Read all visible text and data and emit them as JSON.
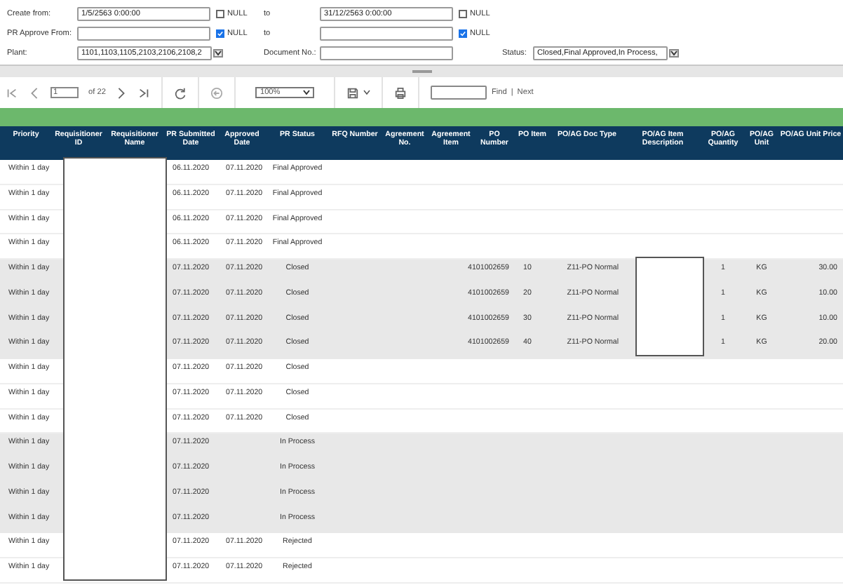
{
  "filters": {
    "rows": [
      {
        "label": "Create from:",
        "value": "1/5/2563 0:00:00",
        "null_label": "NULL",
        "null_checked": false,
        "to_label": "to",
        "to_value": "31/12/2563 0:00:00",
        "to_null_label": "NULL",
        "to_null_checked": false
      },
      {
        "label": "PR Approve From:",
        "null_label": "NULL",
        "null_checked": true,
        "to_label": "to",
        "to_null_label": "NULL",
        "to_null_checked": true
      }
    ],
    "plant": {
      "label": "Plant:",
      "value": "1101,1103,1105,2103,2106,2108,2"
    },
    "document": {
      "label": "Document No.:"
    },
    "status": {
      "label": "Status:",
      "value": "Closed,Final Approved,In Process,"
    }
  },
  "toolbar": {
    "page": "1",
    "of_label": "of 22",
    "zoom": "100%",
    "find_label": "Find",
    "separator": "|",
    "next_label": "Next"
  },
  "table": {
    "columns": [
      "Priority",
      "Requisitioner ID",
      "Requisitioner Name",
      "PR Submitted Date",
      "Approved Date",
      "PR Status",
      "RFQ Number",
      "Agreement No.",
      "Agreement Item",
      "PO Number",
      "PO Item",
      "PO/AG Doc Type",
      "PO/AG Item Description",
      "PO/AG Quantity",
      "PO/AG Unit",
      "PO/AG Unit Price"
    ],
    "rows": [
      {
        "shaded": false,
        "requisitioner_redacted": true,
        "description_redacted": false,
        "priority": "Within 1 day",
        "submitted": "06.11.2020",
        "approved": "07.11.2020",
        "status": "Final Approved"
      },
      {
        "shaded": false,
        "requisitioner_redacted": true,
        "description_redacted": false,
        "priority": "Within 1 day",
        "submitted": "06.11.2020",
        "approved": "07.11.2020",
        "status": "Final Approved"
      },
      {
        "shaded": false,
        "requisitioner_redacted": true,
        "description_redacted": false,
        "priority": "Within 1 day",
        "submitted": "06.11.2020",
        "approved": "07.11.2020",
        "status": "Final Approved"
      },
      {
        "shaded": false,
        "requisitioner_redacted": true,
        "description_redacted": false,
        "priority": "Within 1 day",
        "submitted": "06.11.2020",
        "approved": "07.11.2020",
        "status": "Final Approved"
      },
      {
        "shaded": true,
        "requisitioner_redacted": true,
        "description_redacted": true,
        "priority": "Within 1 day",
        "submitted": "07.11.2020",
        "approved": "07.11.2020",
        "status": "Closed",
        "po_number": "4101002659",
        "po_item": "10",
        "doc_type": "Z11-PO Normal",
        "quantity": "1",
        "unit": "KG",
        "unit_price": "30.00"
      },
      {
        "shaded": true,
        "requisitioner_redacted": true,
        "description_redacted": true,
        "priority": "Within 1 day",
        "submitted": "07.11.2020",
        "approved": "07.11.2020",
        "status": "Closed",
        "po_number": "4101002659",
        "po_item": "20",
        "doc_type": "Z11-PO Normal",
        "quantity": "1",
        "unit": "KG",
        "unit_price": "10.00"
      },
      {
        "shaded": true,
        "requisitioner_redacted": true,
        "description_redacted": true,
        "priority": "Within 1 day",
        "submitted": "07.11.2020",
        "approved": "07.11.2020",
        "status": "Closed",
        "po_number": "4101002659",
        "po_item": "30",
        "doc_type": "Z11-PO Normal",
        "quantity": "1",
        "unit": "KG",
        "unit_price": "10.00"
      },
      {
        "shaded": true,
        "requisitioner_redacted": true,
        "description_redacted": true,
        "priority": "Within 1 day",
        "submitted": "07.11.2020",
        "approved": "07.11.2020",
        "status": "Closed",
        "po_number": "4101002659",
        "po_item": "40",
        "doc_type": "Z11-PO Normal",
        "quantity": "1",
        "unit": "KG",
        "unit_price": "20.00"
      },
      {
        "shaded": false,
        "requisitioner_redacted": true,
        "description_redacted": false,
        "priority": "Within 1 day",
        "submitted": "07.11.2020",
        "approved": "07.11.2020",
        "status": "Closed"
      },
      {
        "shaded": false,
        "requisitioner_redacted": true,
        "description_redacted": false,
        "priority": "Within 1 day",
        "submitted": "07.11.2020",
        "approved": "07.11.2020",
        "status": "Closed"
      },
      {
        "shaded": false,
        "requisitioner_redacted": true,
        "description_redacted": false,
        "priority": "Within 1 day",
        "submitted": "07.11.2020",
        "approved": "07.11.2020",
        "status": "Closed"
      },
      {
        "shaded": true,
        "requisitioner_redacted": true,
        "description_redacted": false,
        "priority": "Within 1 day",
        "submitted": "07.11.2020",
        "status": "In Process"
      },
      {
        "shaded": true,
        "requisitioner_redacted": true,
        "description_redacted": false,
        "priority": "Within 1 day",
        "submitted": "07.11.2020",
        "status": "In Process"
      },
      {
        "shaded": true,
        "requisitioner_redacted": true,
        "description_redacted": false,
        "priority": "Within 1 day",
        "submitted": "07.11.2020",
        "status": "In Process"
      },
      {
        "shaded": true,
        "requisitioner_redacted": true,
        "description_redacted": false,
        "priority": "Within 1 day",
        "submitted": "07.11.2020",
        "status": "In Process"
      },
      {
        "shaded": false,
        "requisitioner_redacted": true,
        "description_redacted": false,
        "priority": "Within 1 day",
        "submitted": "07.11.2020",
        "approved": "07.11.2020",
        "status": "Rejected"
      },
      {
        "shaded": false,
        "requisitioner_redacted": true,
        "description_redacted": false,
        "priority": "Within 1 day",
        "submitted": "07.11.2020",
        "approved": "07.11.2020",
        "status": "Rejected"
      }
    ]
  }
}
